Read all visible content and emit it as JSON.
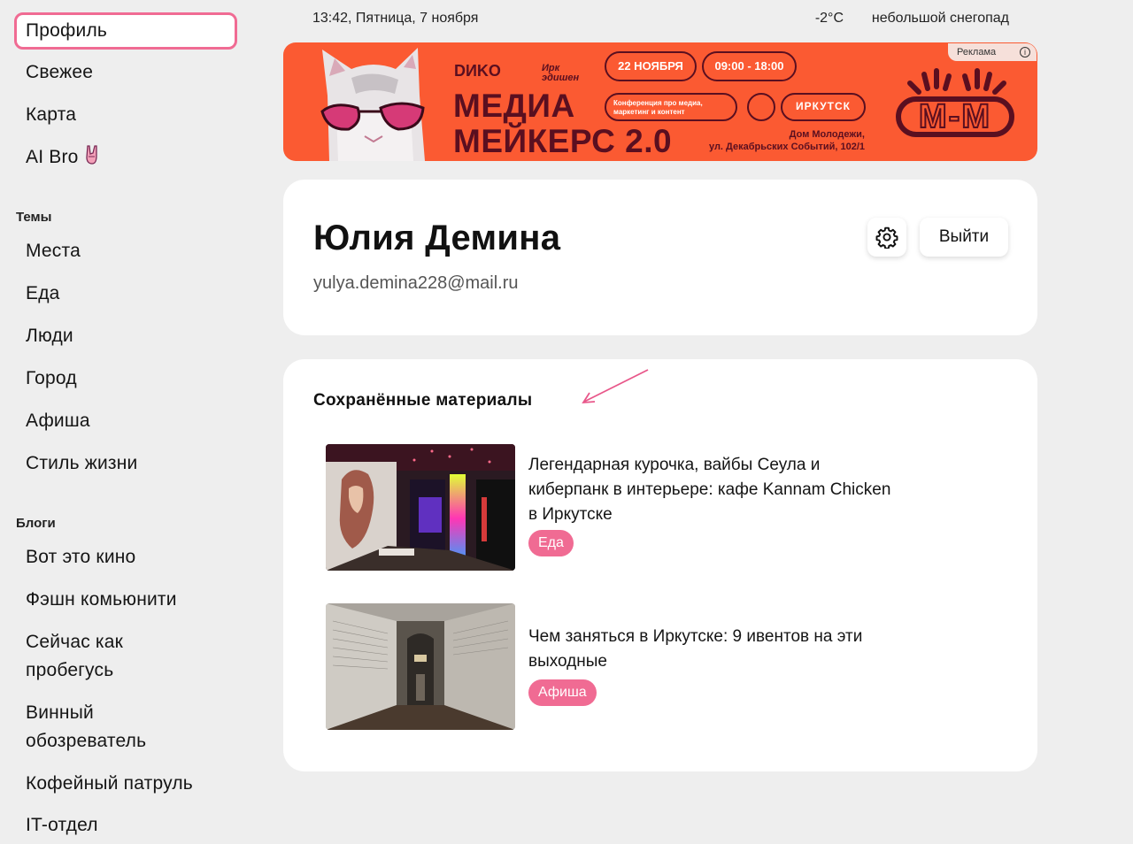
{
  "sidebar": {
    "profile": "Профиль",
    "fresh": "Свежее",
    "map": "Карта",
    "ai": "AI Bro",
    "topics_heading": "Темы",
    "topics": [
      "Места",
      "Еда",
      "Люди",
      "Город",
      "Афиша",
      "Стиль жизни"
    ],
    "blogs_heading": "Блоги",
    "blogs": [
      "Вот это кино",
      "Фэшн комьюнити",
      "Сейчас как",
      "пробегусь",
      "Винный",
      "обозреватель",
      "Кофейный патруль",
      "IT-отдел"
    ]
  },
  "topbar": {
    "datetime": "13:42, Пятница, 7 ноября",
    "temperature": "-2°C",
    "weather": "небольшой снегопад"
  },
  "ad": {
    "label": "Реклама",
    "info_icon": "info-icon",
    "brand1": "DИKO",
    "brand2": "Ирк эдишен",
    "date": "22 НОЯБРЯ",
    "time": "09:00 - 18:00",
    "line1": "МЕДИА",
    "line2": "МЕЙКЕРС 2.0",
    "conf": "Конференция про медиа, маркетинг и контент",
    "city": "ИРКУТСК",
    "venue": "Дом Молодежи,",
    "street": "ул. Декабрьских Событий, 102/1",
    "logo": "M-M",
    "colors": {
      "bg": "#fb5a32",
      "ink": "#5a0f20"
    }
  },
  "profile": {
    "name": "Юлия Демина",
    "email": "yulya.demina228@mail.ru",
    "settings_icon": "gear-icon",
    "logout": "Выйти"
  },
  "saved": {
    "title": "Сохранённые материалы",
    "articles": [
      {
        "title_lines": [
          "Легендарная курочка, вайбы Сеула и",
          "киберпанк в интерьере: кафе Kannam Chicken",
          "в Иркутске"
        ],
        "tag": "Еда"
      },
      {
        "title_lines": [
          "Чем заняться в Иркутске: 9 ивентов на эти",
          "выходные"
        ],
        "tag": "Афиша"
      }
    ]
  },
  "accent": "#f06b93"
}
